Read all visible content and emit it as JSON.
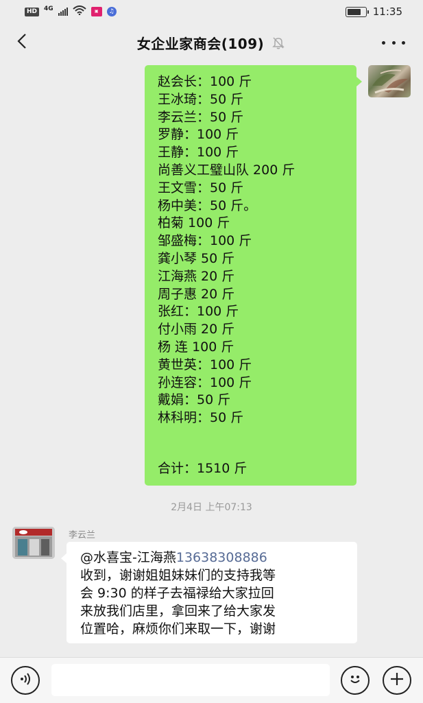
{
  "status_bar": {
    "hd_label": "HD",
    "network_label": "4G",
    "time": "11:35",
    "battery_level": 0.75
  },
  "header": {
    "title": "女企业家商会(109)",
    "back_icon": "chevron-left-icon",
    "mute_icon": "bell-off-icon",
    "more_icon": "more-dots-icon"
  },
  "messages": {
    "outgoing": {
      "lines": [
        "赵会长：100 斤",
        "王冰琦：50 斤",
        "李云兰：50 斤",
        "罗静：100 斤",
        "王静：100 斤",
        "尚善义工璧山队  200 斤",
        "王文雪：50 斤",
        "杨中美：50 斤。",
        "柏菊 100 斤",
        "邹盛梅：100 斤",
        "龚小琴 50 斤",
        "江海燕 20 斤",
        "周子惠 20 斤",
        "张红：100 斤",
        "付小雨 20 斤",
        "杨  连 100 斤",
        "黄世英：100 斤",
        "孙连容：100 斤",
        "戴娟：50 斤",
        "林科明：50 斤"
      ],
      "total": "合计：1510 斤"
    },
    "timestamp": "2月4日 上午07:13",
    "incoming": {
      "sender": "李云兰",
      "mention": "@水喜宝-江海燕",
      "phone": "13638308886",
      "lines": [
        "收到，谢谢姐姐妹妹们的支持我等",
        "会 9:30 的样子去福禄给大家拉回",
        "来放我们店里，拿回来了给大家发",
        "位置哈，麻烦你们来取一下，谢谢"
      ]
    }
  },
  "input_bar": {
    "placeholder": "",
    "voice_icon": "voice-icon",
    "emoji_icon": "emoji-icon",
    "plus_icon": "plus-icon"
  },
  "colors": {
    "outgoing_bubble": "#95ec69",
    "incoming_bubble": "#ffffff",
    "background": "#ededed",
    "link": "#576b95"
  }
}
